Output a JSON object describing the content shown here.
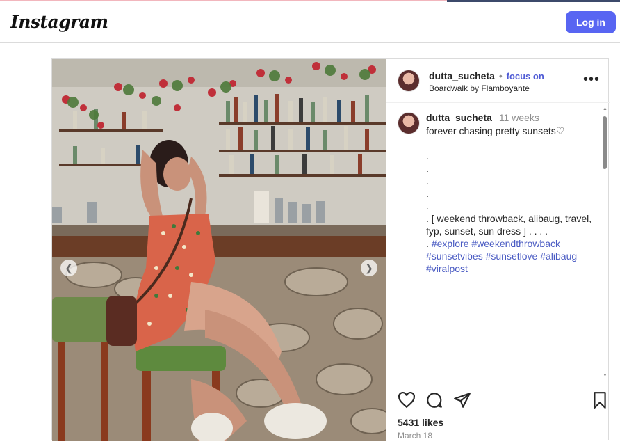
{
  "app": {
    "logo": "Instagram",
    "login_label": "Log in"
  },
  "post": {
    "username": "dutta_sucheta",
    "follow_label": "focus on",
    "location": "Boardwalk by Flamboyante",
    "time_ago": "11 weeks",
    "caption_text": "forever chasing pretty sunsets♡\n\n.\n.\n.\n.\n.\n. [ weekend throwback, alibaug, travel, fyp, sunset, sun dress ] . . . .",
    "hashtags": [
      "#explore",
      "#weekendthrowback",
      "#sunsetvibes",
      "#sunsetlove",
      "#alibaug",
      "#viralpost"
    ],
    "likes": "5431 likes",
    "date": "March 18"
  },
  "icons": {
    "more": "more-horizontal-icon",
    "like": "heart-icon",
    "comment": "comment-icon",
    "share": "share-icon",
    "save": "bookmark-icon",
    "prev": "chevron-left-icon",
    "next": "chevron-right-icon"
  },
  "colors": {
    "login_bg": "#5865f2",
    "follow_link": "#4f5bd5",
    "hashtag": "#4a5bc3"
  }
}
